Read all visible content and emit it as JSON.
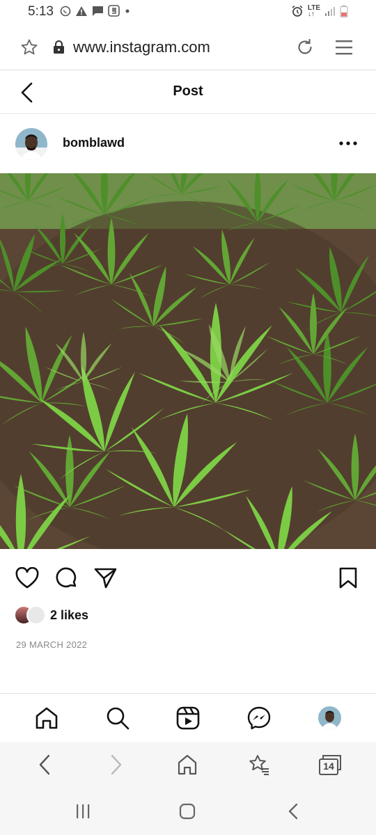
{
  "status_bar": {
    "time": "5:13",
    "network": "LTE",
    "icons": [
      "whatsapp-icon",
      "warning-icon",
      "message-icon",
      "app-icon",
      "dot-icon",
      "alarm-icon",
      "signal-icon",
      "battery-icon"
    ]
  },
  "browser": {
    "url": "www.instagram.com",
    "icons": [
      "star-icon",
      "lock-icon",
      "reload-icon",
      "menu-icon"
    ]
  },
  "page": {
    "title": "Post"
  },
  "post": {
    "username": "bomblawd",
    "likes_text": "2 likes",
    "date": "29 MARCH 2022",
    "image_subject": "cannabis plants growing in a field"
  },
  "colors": {
    "text": "#111111",
    "muted": "#888888",
    "divider": "#dddddd",
    "browser_bar": "#f6f6f6",
    "plant_green": "#6fbf3a",
    "soil": "#5a4332"
  },
  "bottom_nav": [
    "home-icon",
    "search-icon",
    "reels-icon",
    "messenger-icon",
    "profile-avatar"
  ],
  "browser_nav": {
    "tab_count": "14",
    "icons": [
      "back-icon",
      "forward-icon",
      "home-icon",
      "bookmark-star-icon",
      "tabs-icon"
    ]
  },
  "system_nav": [
    "recents-icon",
    "home-button-icon",
    "back-icon"
  ]
}
